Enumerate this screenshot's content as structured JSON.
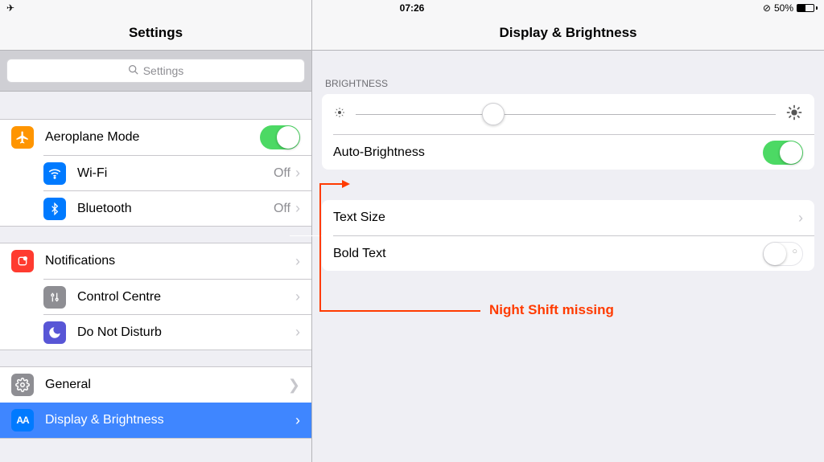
{
  "statusbar": {
    "time": "07:26",
    "battery_percent": "50%"
  },
  "sidebar": {
    "title": "Settings",
    "search_placeholder": "Settings",
    "groups": [
      {
        "items": [
          {
            "key": "airplane",
            "label": "Aeroplane Mode",
            "icon_bg": "#ff9500",
            "toggle": true,
            "toggle_on": true
          },
          {
            "key": "wifi",
            "label": "Wi-Fi",
            "icon_bg": "#007aff",
            "value": "Off",
            "chevron": true
          },
          {
            "key": "bluetooth",
            "label": "Bluetooth",
            "icon_bg": "#007aff",
            "value": "Off",
            "chevron": true
          }
        ]
      },
      {
        "items": [
          {
            "key": "notifications",
            "label": "Notifications",
            "icon_bg": "#ff3b30",
            "chevron": true
          },
          {
            "key": "control-centre",
            "label": "Control Centre",
            "icon_bg": "#8e8e93",
            "chevron": true
          },
          {
            "key": "dnd",
            "label": "Do Not Disturb",
            "icon_bg": "#5856d6",
            "chevron": true
          }
        ]
      },
      {
        "items": [
          {
            "key": "general",
            "label": "General",
            "icon_bg": "#8e8e93",
            "chevron": true,
            "big_chevron": true
          },
          {
            "key": "display",
            "label": "Display & Brightness",
            "icon_bg": "#007aff",
            "chevron": true,
            "selected": true
          }
        ]
      }
    ]
  },
  "main": {
    "title": "Display & Brightness",
    "brightness_header": "BRIGHTNESS",
    "auto_brightness_label": "Auto-Brightness",
    "auto_brightness_on": true,
    "brightness_value_percent": 32,
    "text_size_label": "Text Size",
    "bold_text_label": "Bold Text",
    "bold_text_on": false
  },
  "annotation": {
    "text": "Night Shift missing"
  }
}
